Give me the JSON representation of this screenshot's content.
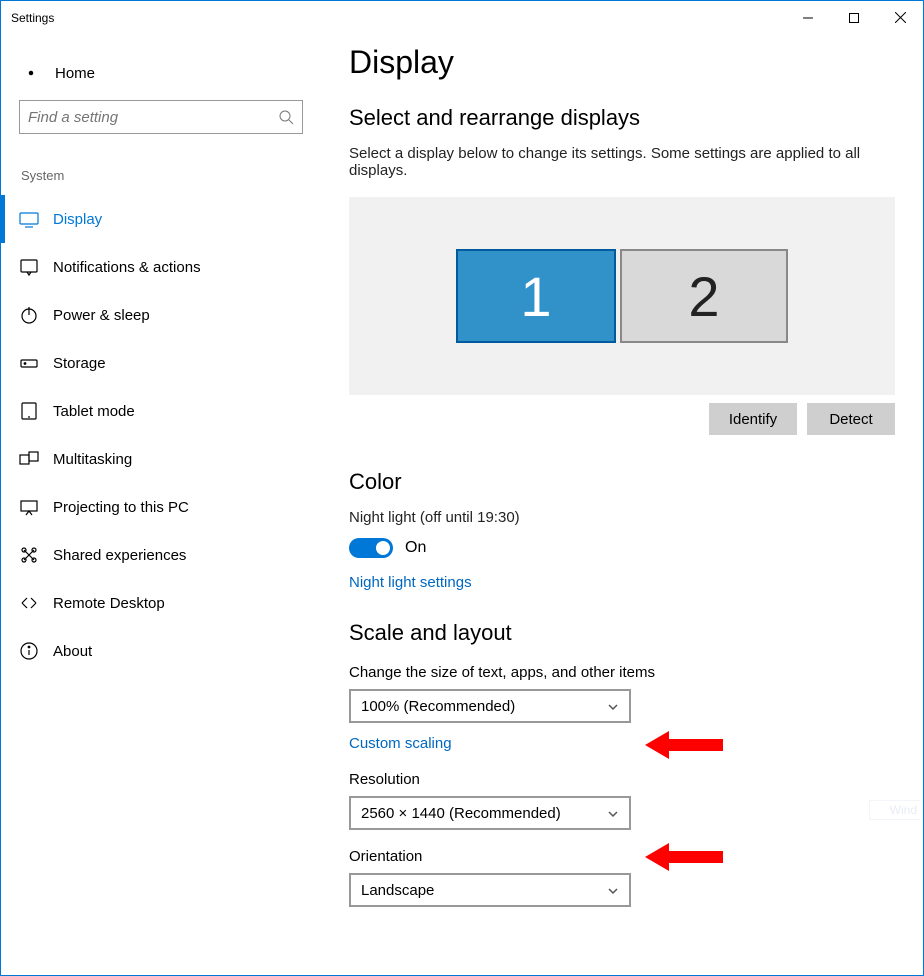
{
  "window": {
    "title": "Settings"
  },
  "sidebar": {
    "home": "Home",
    "search_placeholder": "Find a setting",
    "category": "System",
    "items": [
      {
        "id": "display",
        "label": "Display",
        "active": true
      },
      {
        "id": "notifications",
        "label": "Notifications & actions",
        "active": false
      },
      {
        "id": "power",
        "label": "Power & sleep",
        "active": false
      },
      {
        "id": "storage",
        "label": "Storage",
        "active": false
      },
      {
        "id": "tablet",
        "label": "Tablet mode",
        "active": false
      },
      {
        "id": "multitasking",
        "label": "Multitasking",
        "active": false
      },
      {
        "id": "projecting",
        "label": "Projecting to this PC",
        "active": false
      },
      {
        "id": "shared",
        "label": "Shared experiences",
        "active": false
      },
      {
        "id": "remote",
        "label": "Remote Desktop",
        "active": false
      },
      {
        "id": "about",
        "label": "About",
        "active": false
      }
    ]
  },
  "main": {
    "title": "Display",
    "arranger": {
      "heading": "Select and rearrange displays",
      "hint": "Select a display below to change its settings. Some settings are applied to all displays.",
      "monitors": [
        {
          "num": "1",
          "selected": true
        },
        {
          "num": "2",
          "selected": false
        }
      ],
      "identify_label": "Identify",
      "detect_label": "Detect"
    },
    "color": {
      "heading": "Color",
      "nightlight_status": "Night light (off until 19:30)",
      "toggle_label": "On",
      "link": "Night light settings"
    },
    "scale": {
      "heading": "Scale and layout",
      "scale_label": "Change the size of text, apps, and other items",
      "scale_value": "100% (Recommended)",
      "custom_link": "Custom scaling",
      "resolution_label": "Resolution",
      "resolution_value": "2560 × 1440 (Recommended)",
      "orientation_label": "Orientation",
      "orientation_value": "Landscape"
    }
  },
  "watermark": "Wind"
}
